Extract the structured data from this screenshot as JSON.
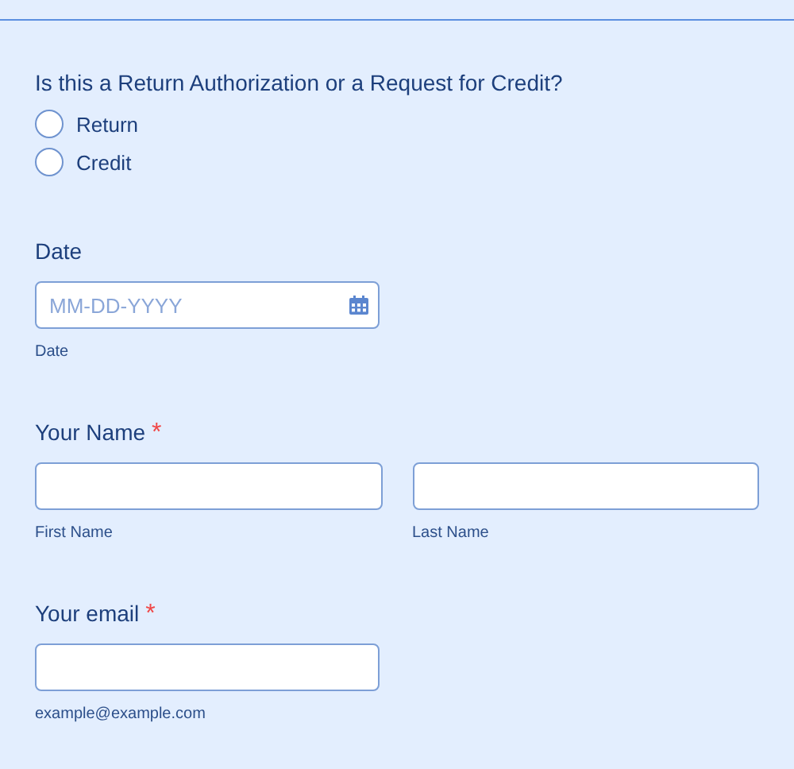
{
  "question": {
    "label": "Is this a Return Authorization or a Request for Credit?",
    "options": [
      {
        "label": "Return",
        "selected": false
      },
      {
        "label": "Credit",
        "selected": false
      }
    ]
  },
  "date": {
    "label": "Date",
    "placeholder": "MM-DD-YYYY",
    "sublabel": "Date"
  },
  "name": {
    "label": "Your Name",
    "required_mark": "*",
    "fields": [
      {
        "sublabel": "First Name"
      },
      {
        "sublabel": "Last Name"
      }
    ]
  },
  "email": {
    "label": "Your email",
    "required_mark": "*",
    "sublabel": "example@example.com"
  }
}
